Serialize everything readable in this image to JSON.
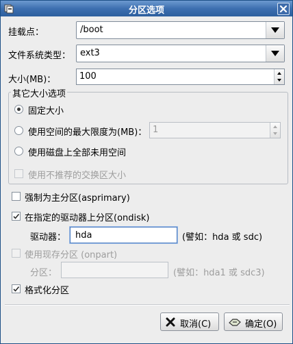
{
  "window": {
    "title": "分区选项",
    "icons": {
      "app": "disk-partition-icon",
      "close": "close-icon"
    }
  },
  "mount": {
    "label": "挂载点：",
    "value": "/boot"
  },
  "fstype": {
    "label": "文件系统类型：",
    "value": "ext3"
  },
  "size": {
    "label": "大小(MB)：",
    "value": "100"
  },
  "other_size": {
    "group_label": "其它大小选项",
    "fixed": "固定大小",
    "max_label": "使用空间的最大限度为(MB)：",
    "max_value": "1",
    "fill_all": "使用磁盘上全部未用空间",
    "recommended_swap": "使用不推荐的交换区大小",
    "selected": "fixed"
  },
  "asprimary": {
    "label": "强制为主分区(asprimary)",
    "checked": false
  },
  "ondisk": {
    "label": "在指定的驱动器上分区(ondisk)",
    "checked": true,
    "drive_label": "驱动器：",
    "drive_value": "hda",
    "drive_hint": "(譬如：hda 或 sdc)"
  },
  "onpart": {
    "label": "使用现存分区 (onpart)",
    "checked": false,
    "part_label": "分区：",
    "part_value": "",
    "part_hint": "(譬如：hda1 或 sdc3)"
  },
  "format": {
    "label": "格式化分区",
    "checked": true
  },
  "buttons": {
    "cancel": "取消(C)",
    "ok": "确定(O)",
    "cancel_icon": "cancel-x-icon",
    "ok_icon": "ok-hand-icon"
  }
}
